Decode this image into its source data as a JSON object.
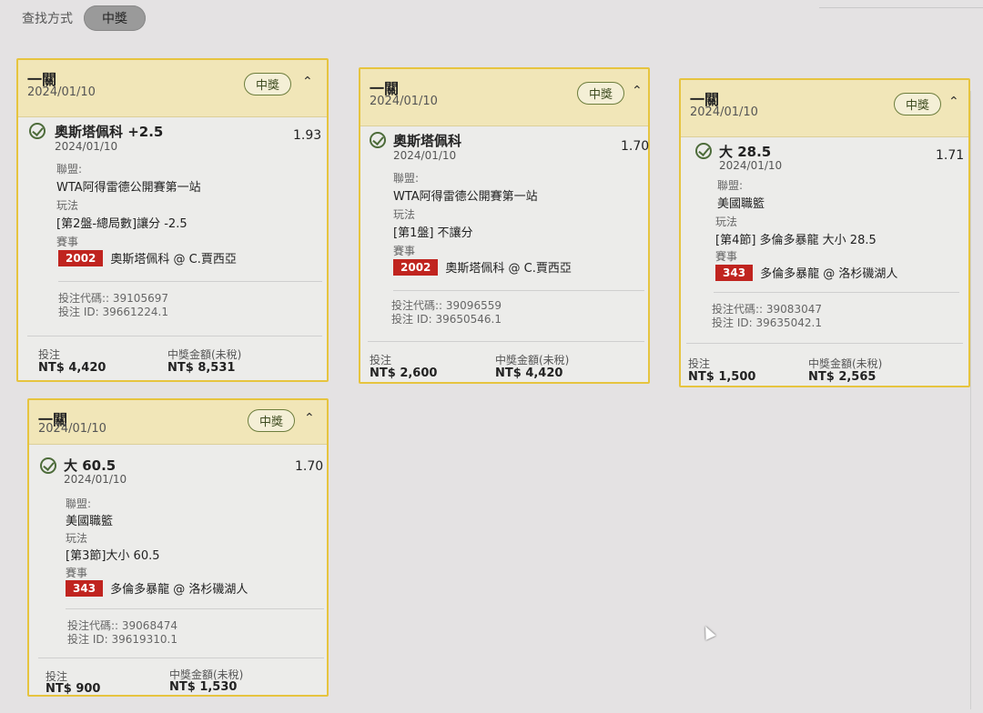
{
  "filter": {
    "label": "查找方式",
    "chip": "中獎"
  },
  "labels": {
    "league": "聯盟:",
    "play": "玩法",
    "event": "賽事",
    "bet": "投注",
    "payout": "中獎金額(未稅)"
  },
  "cards": [
    {
      "type": "一關",
      "date": "2024/01/10",
      "status": "中獎",
      "selection": "奧斯塔佩科 +2.5",
      "sel_date": "2024/01/10",
      "odds": "1.93",
      "league": "WTA阿得雷德公開賽第一站",
      "play": "[第2盤-總局數]讓分 -2.5",
      "game_code": "2002",
      "game": "奧斯塔佩科 @ C.賈西亞",
      "bet_code": "投注代碼:: 39105697",
      "bet_id": "投注 ID: 39661224.1",
      "stake": "NT$ 4,420",
      "payout": "NT$ 8,531"
    },
    {
      "type": "一關",
      "date": "2024/01/10",
      "status": "中獎",
      "selection": "奧斯塔佩科",
      "sel_date": "2024/01/10",
      "odds": "1.70",
      "league": "WTA阿得雷德公開賽第一站",
      "play": "[第1盤] 不讓分",
      "game_code": "2002",
      "game": "奧斯塔佩科 @ C.賈西亞",
      "bet_code": "投注代碼:: 39096559",
      "bet_id": "投注 ID: 39650546.1",
      "stake": "NT$ 2,600",
      "payout": "NT$ 4,420"
    },
    {
      "type": "一關",
      "date": "2024/01/10",
      "status": "中獎",
      "selection": "大 28.5",
      "sel_date": "2024/01/10",
      "odds": "1.71",
      "league": "美國職籃",
      "play": "[第4節] 多倫多暴龍 大小 28.5",
      "game_code": "343",
      "game": "多倫多暴龍 @ 洛杉磯湖人",
      "bet_code": "投注代碼:: 39083047",
      "bet_id": "投注 ID: 39635042.1",
      "stake": "NT$ 1,500",
      "payout": "NT$ 2,565"
    },
    {
      "type": "一關",
      "date": "2024/01/10",
      "status": "中獎",
      "selection": "大 60.5",
      "sel_date": "2024/01/10",
      "odds": "1.70",
      "league": "美國職籃",
      "play": "[第3節]大小 60.5",
      "game_code": "343",
      "game": "多倫多暴龍 @ 洛杉磯湖人",
      "bet_code": "投注代碼:: 39068474",
      "bet_id": "投注 ID: 39619310.1",
      "stake": "NT$ 900",
      "payout": "NT$ 1,530"
    }
  ]
}
